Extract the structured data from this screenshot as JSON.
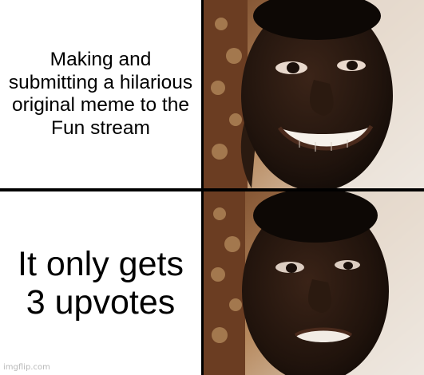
{
  "panels": {
    "top": {
      "caption": "Making and submitting a hilarious original meme to the Fun stream"
    },
    "bottom": {
      "caption": "It only gets 3 upvotes"
    }
  },
  "watermark": "imgflip.com",
  "images": {
    "top": {
      "subject": "smiling-man-photo"
    },
    "bottom": {
      "subject": "disappointed-man-photo"
    }
  }
}
